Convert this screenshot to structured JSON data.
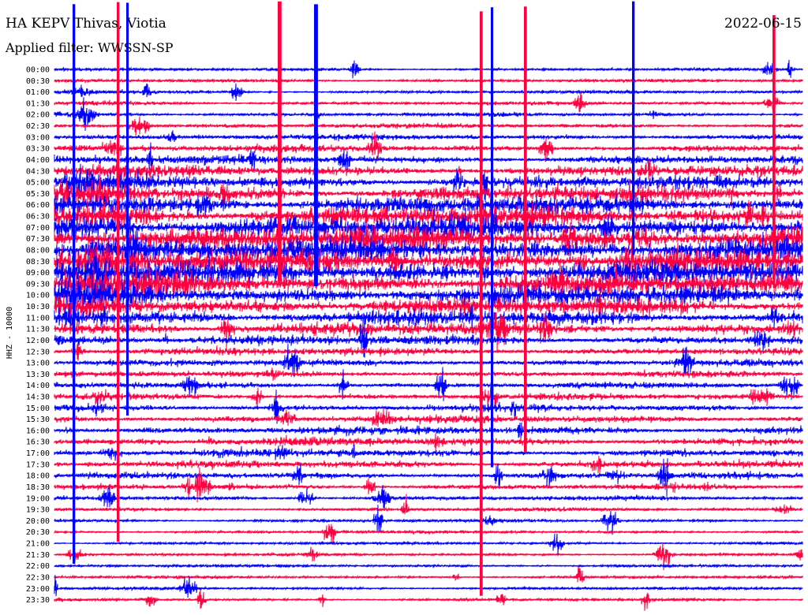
{
  "header": {
    "title": "HA KEPV Thivas, Viotia",
    "date": "2022-06-15",
    "filter": "Applied filter: WWSSN-SP"
  },
  "chart_data": {
    "type": "line",
    "title": "HA KEPV Thivas, Viotia",
    "subtitle": "Applied filter: WWSSN-SP",
    "date": "2022-06-15",
    "ylabel": "HHZ - 10000",
    "colors": [
      "#0000ff",
      "#ff0040"
    ],
    "row_labels": [
      "00:00",
      "00:30",
      "01:00",
      "01:30",
      "02:00",
      "02:30",
      "03:00",
      "03:30",
      "04:00",
      "04:30",
      "05:00",
      "05:30",
      "06:00",
      "06:30",
      "07:00",
      "07:30",
      "08:00",
      "08:30",
      "09:00",
      "09:30",
      "10:00",
      "10:30",
      "11:00",
      "11:30",
      "12:00",
      "12:30",
      "13:00",
      "13:30",
      "14:00",
      "14:30",
      "15:00",
      "15:30",
      "16:00",
      "16:30",
      "17:00",
      "17:30",
      "18:00",
      "18:30",
      "19:00",
      "19:30",
      "20:00",
      "20:30",
      "21:00",
      "21:30",
      "22:00",
      "22:30",
      "23:00",
      "23:30"
    ]
  }
}
